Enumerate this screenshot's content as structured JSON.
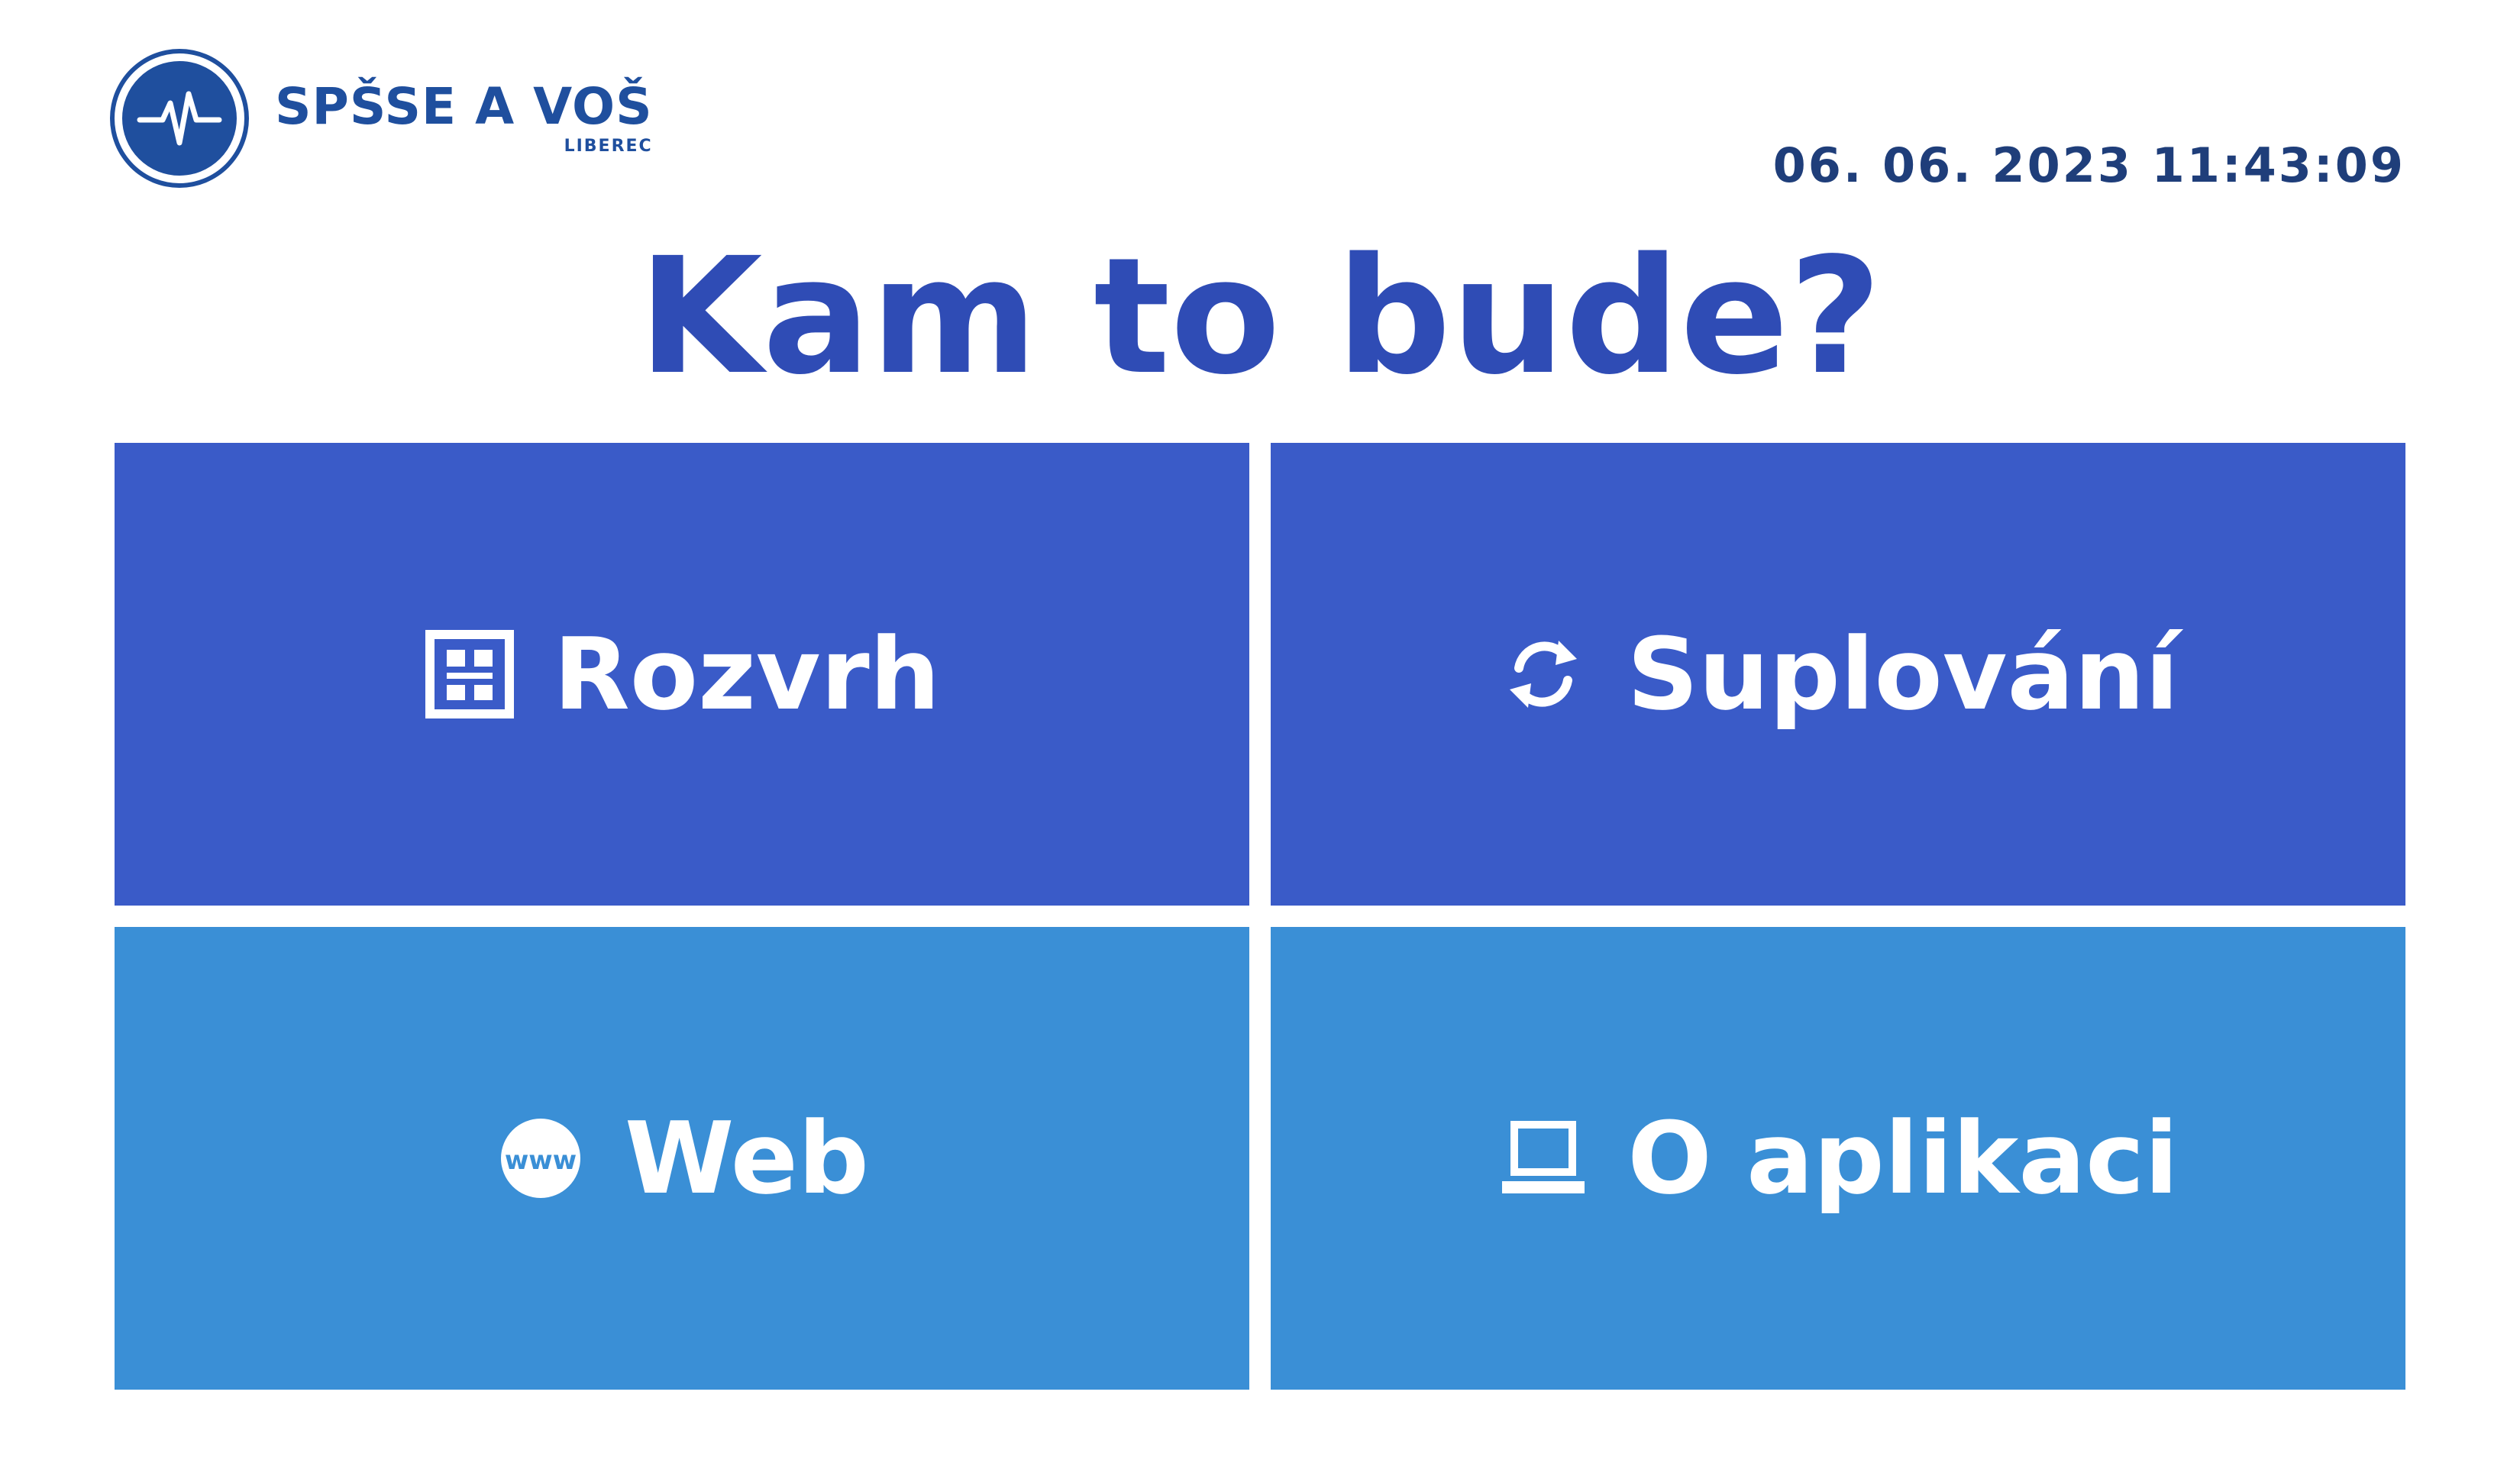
{
  "header": {
    "brand_name": "SPŠSE A VOŠ",
    "brand_city": "LIBEREC",
    "datetime": "06. 06. 2023 11:43:09"
  },
  "main": {
    "title": "Kam to bude?"
  },
  "menu": {
    "items": [
      {
        "label": "Rozvrh",
        "icon": "schedule-grid-icon"
      },
      {
        "label": "Suplování",
        "icon": "refresh-icon"
      },
      {
        "label": "Web",
        "icon": "globe-icon"
      },
      {
        "label": "O aplikaci",
        "icon": "laptop-icon"
      }
    ]
  },
  "colors": {
    "brand": "#1f4f9e",
    "title": "#2f4cb5",
    "tile_top": "#3a5bc8",
    "tile_bottom": "#3a8fd6"
  }
}
